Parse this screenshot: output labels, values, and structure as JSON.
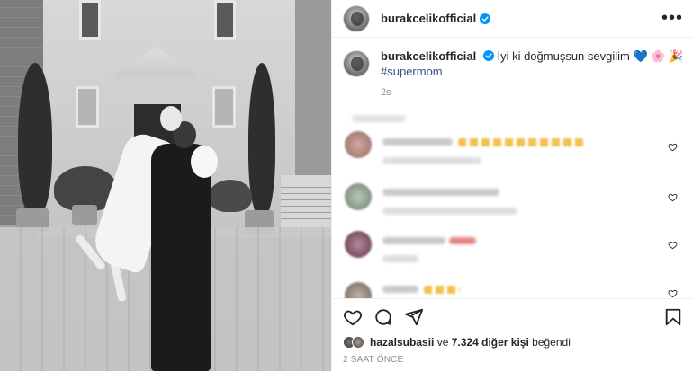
{
  "post": {
    "username": "burakcelikofficial",
    "verified_icon": "verified-badge-icon",
    "more_icon": "more-options-icon"
  },
  "caption": {
    "username": "burakcelikofficial",
    "text": "İyi ki doğmuşsun sevgilim",
    "emojis": [
      "blue-heart",
      "flower",
      "party-popper"
    ],
    "hashtag": "#supermom",
    "time": "2s"
  },
  "actions": {
    "like_icon": "heart-icon",
    "comment_icon": "comment-icon",
    "share_icon": "share-icon",
    "save_icon": "bookmark-icon"
  },
  "likes": {
    "first_user": "hazalsubasii",
    "connector": "ve",
    "others_count": "7.324 diğer kişi",
    "suffix": "beğendi"
  },
  "posted_ago": "2 SAAT ÖNCE",
  "colors": {
    "verified": "#0095f6",
    "hashtag": "#385185",
    "border": "#efefef",
    "secondary_text": "#8e8e8e"
  }
}
